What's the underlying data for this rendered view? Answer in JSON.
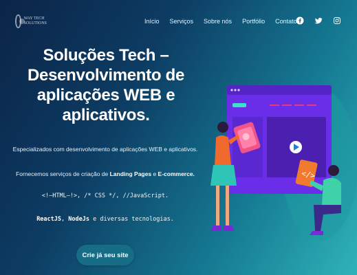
{
  "brand": {
    "logo_line1": "WAY TECH",
    "logo_line2": "SOLUTIONS"
  },
  "nav": {
    "items": [
      {
        "label": "Início"
      },
      {
        "label": "Serviços"
      },
      {
        "label": "Sobre nós"
      },
      {
        "label": "Portfólio"
      },
      {
        "label": "Contato"
      }
    ]
  },
  "social": {
    "icons": [
      "facebook-icon",
      "twitter-icon",
      "instagram-icon"
    ]
  },
  "hero": {
    "title": "Soluções Tech – Desenvolvimento de aplicações WEB e aplicativos.",
    "p1": "Especializados com desenvolvimento de aplicações WEB e aplicativos.",
    "p2_prefix": "Fornecemos serviços de criação de ",
    "p2_strong1": "Landing Pages",
    "p2_mid": " e ",
    "p2_strong2": "E-commerce.",
    "p3": "<!–HTML–!>, /* CSS */, //JavaScript.",
    "p4_strong1": "ReactJS",
    "p4_sep": ", ",
    "p4_strong2": "NodeJs",
    "p4_suffix": " e diversas tecnologias.",
    "cta_label": "Crie já seu site"
  },
  "colors": {
    "bg_start": "#0b2447",
    "bg_end": "#2fb3b8",
    "cta": "#176c86",
    "illustration_purple": "#6a2ee8"
  }
}
